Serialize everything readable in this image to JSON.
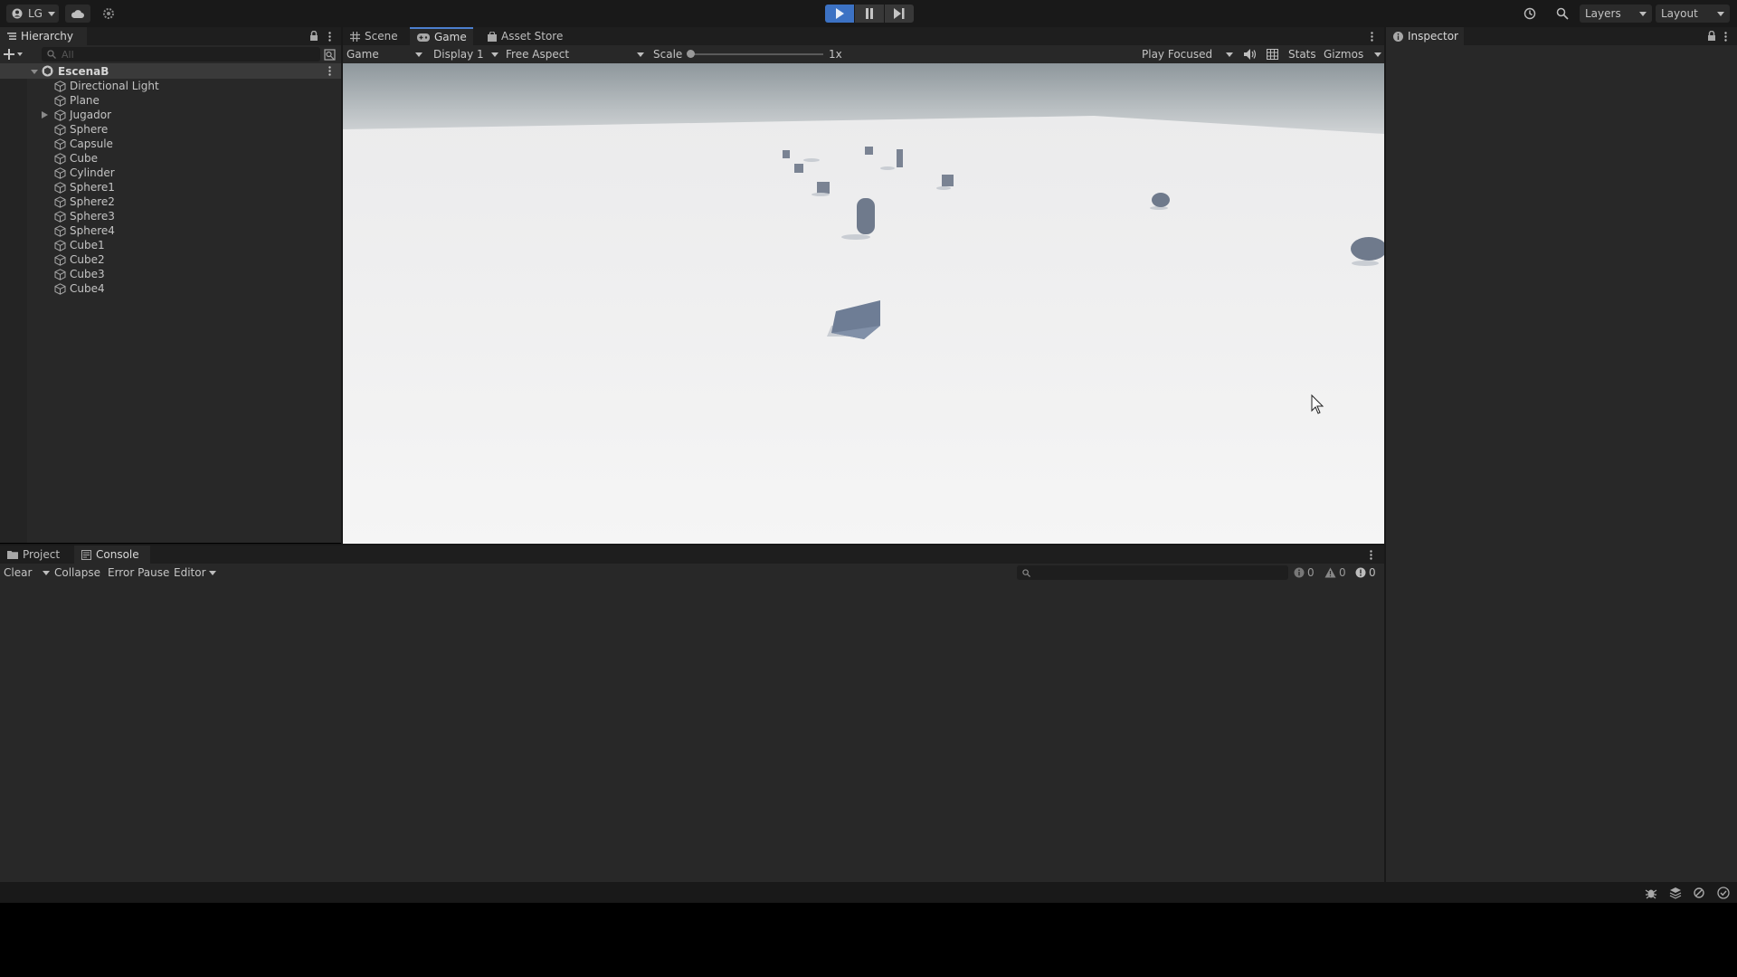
{
  "toolbar": {
    "account_label": "LG",
    "layers_label": "Layers",
    "layout_label": "Layout"
  },
  "hierarchy": {
    "tab_label": "Hierarchy",
    "search_placeholder": "All",
    "scene_name": "EscenaB",
    "items": [
      {
        "label": "Directional Light"
      },
      {
        "label": "Plane"
      },
      {
        "label": "Jugador"
      },
      {
        "label": "Sphere"
      },
      {
        "label": "Capsule"
      },
      {
        "label": "Cube"
      },
      {
        "label": "Cylinder"
      },
      {
        "label": "Sphere1"
      },
      {
        "label": "Sphere2"
      },
      {
        "label": "Sphere3"
      },
      {
        "label": "Sphere4"
      },
      {
        "label": "Cube1"
      },
      {
        "label": "Cube2"
      },
      {
        "label": "Cube3"
      },
      {
        "label": "Cube4"
      }
    ]
  },
  "view_tabs": [
    "Scene",
    "Game",
    "Asset Store"
  ],
  "game_bar": {
    "mode": "Game",
    "display": "Display 1",
    "aspect": "Free Aspect",
    "scale_label": "Scale",
    "scale_value": "1x",
    "play_mode": "Play Focused",
    "stats": "Stats",
    "gizmos": "Gizmos"
  },
  "inspector": {
    "tab_label": "Inspector"
  },
  "bottom_tabs": [
    "Project",
    "Console"
  ],
  "console": {
    "clear": "Clear",
    "collapse": "Collapse",
    "error_pause": "Error Pause",
    "editor": "Editor",
    "log_count": "0",
    "warn_count": "0",
    "error_count": "0"
  },
  "colors": {
    "accent": "#4c7fcf",
    "panel": "#282828",
    "toolbar": "#191919",
    "sky": "#9aa3a8",
    "ground": "#f4f4f4",
    "object": "#6f7a8c"
  }
}
